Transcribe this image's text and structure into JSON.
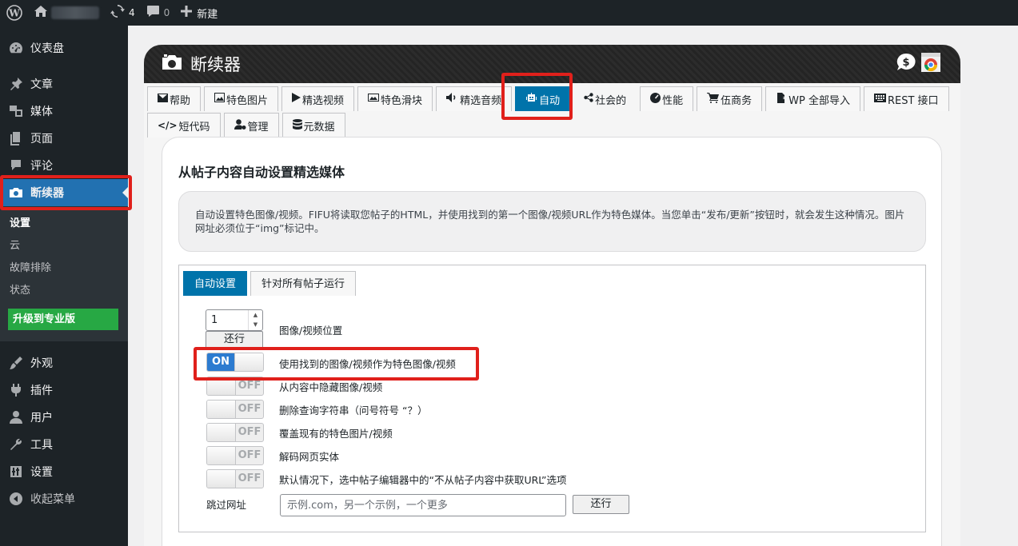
{
  "adminbar": {
    "updates_count": "4",
    "comments_count": "0",
    "new_label": "新建"
  },
  "sidebar": {
    "items_top": [
      {
        "label": "仪表盘",
        "icon": "dashboard-icon"
      },
      {
        "label": "文章",
        "icon": "pin-icon"
      },
      {
        "label": "媒体",
        "icon": "media-icon"
      },
      {
        "label": "页面",
        "icon": "page-icon"
      },
      {
        "label": "评论",
        "icon": "comment-icon"
      },
      {
        "label": "断续器",
        "icon": "camera-icon"
      }
    ],
    "submenu": [
      "设置",
      "云",
      "故障排除",
      "状态"
    ],
    "upgrade_label": "升级到专业版",
    "items_bottom": [
      {
        "label": "外观",
        "icon": "brush-icon"
      },
      {
        "label": "插件",
        "icon": "plugin-icon"
      },
      {
        "label": "用户",
        "icon": "user-icon"
      },
      {
        "label": "工具",
        "icon": "wrench-icon"
      },
      {
        "label": "设置",
        "icon": "settings-icon"
      },
      {
        "label": "收起菜单",
        "icon": "collapse-icon"
      }
    ]
  },
  "panel": {
    "title": "断续器",
    "tabs_row1": [
      "帮助",
      "特色图片",
      "精选视频",
      "特色滑块",
      "精选音频",
      "自动",
      "社会的",
      "性能",
      "伍商务",
      "WP 全部导入",
      "REST 接口"
    ],
    "tabs_row2": [
      "短代码",
      "管理",
      "元数据"
    ],
    "active_tab": "自动"
  },
  "content": {
    "section_title": "从帖子内容自动设置精选媒体",
    "description": "自动设置特色图像/视频。FIFU将读取您帖子的HTML，并使用找到的第一个图像/视频URL作为特色媒体。当您单击“发布/更新”按钮时，就会发生这种情况。图片网址必须位于“img”标记中。",
    "sub_tabs": [
      "自动设置",
      "针对所有帖子运行"
    ],
    "position_value": "1",
    "run_label": "还行",
    "position_label": "图像/视频位置",
    "toggles": [
      {
        "state": "ON",
        "label": "使用找到的图像/视频作为特色图像/视频"
      },
      {
        "state": "OFF",
        "label": "从内容中隐藏图像/视频"
      },
      {
        "state": "OFF",
        "label": "删除查询字符串（问号符号 “？）"
      },
      {
        "state": "OFF",
        "label": "覆盖现有的特色图片/视频"
      },
      {
        "state": "OFF",
        "label": "解码网页实体"
      },
      {
        "state": "OFF",
        "label": "默认情况下，选中帖子编辑器中的“不从帖子内容中获取URL”选项"
      }
    ],
    "skip_url_label": "跳过网址",
    "skip_url_placeholder": "示例.com，另一个示例，一个更多",
    "skip_url_button": "还行"
  },
  "colors": {
    "accent": "#0073aa",
    "highlight": "#e0201b",
    "upgrade": "#27a844"
  }
}
